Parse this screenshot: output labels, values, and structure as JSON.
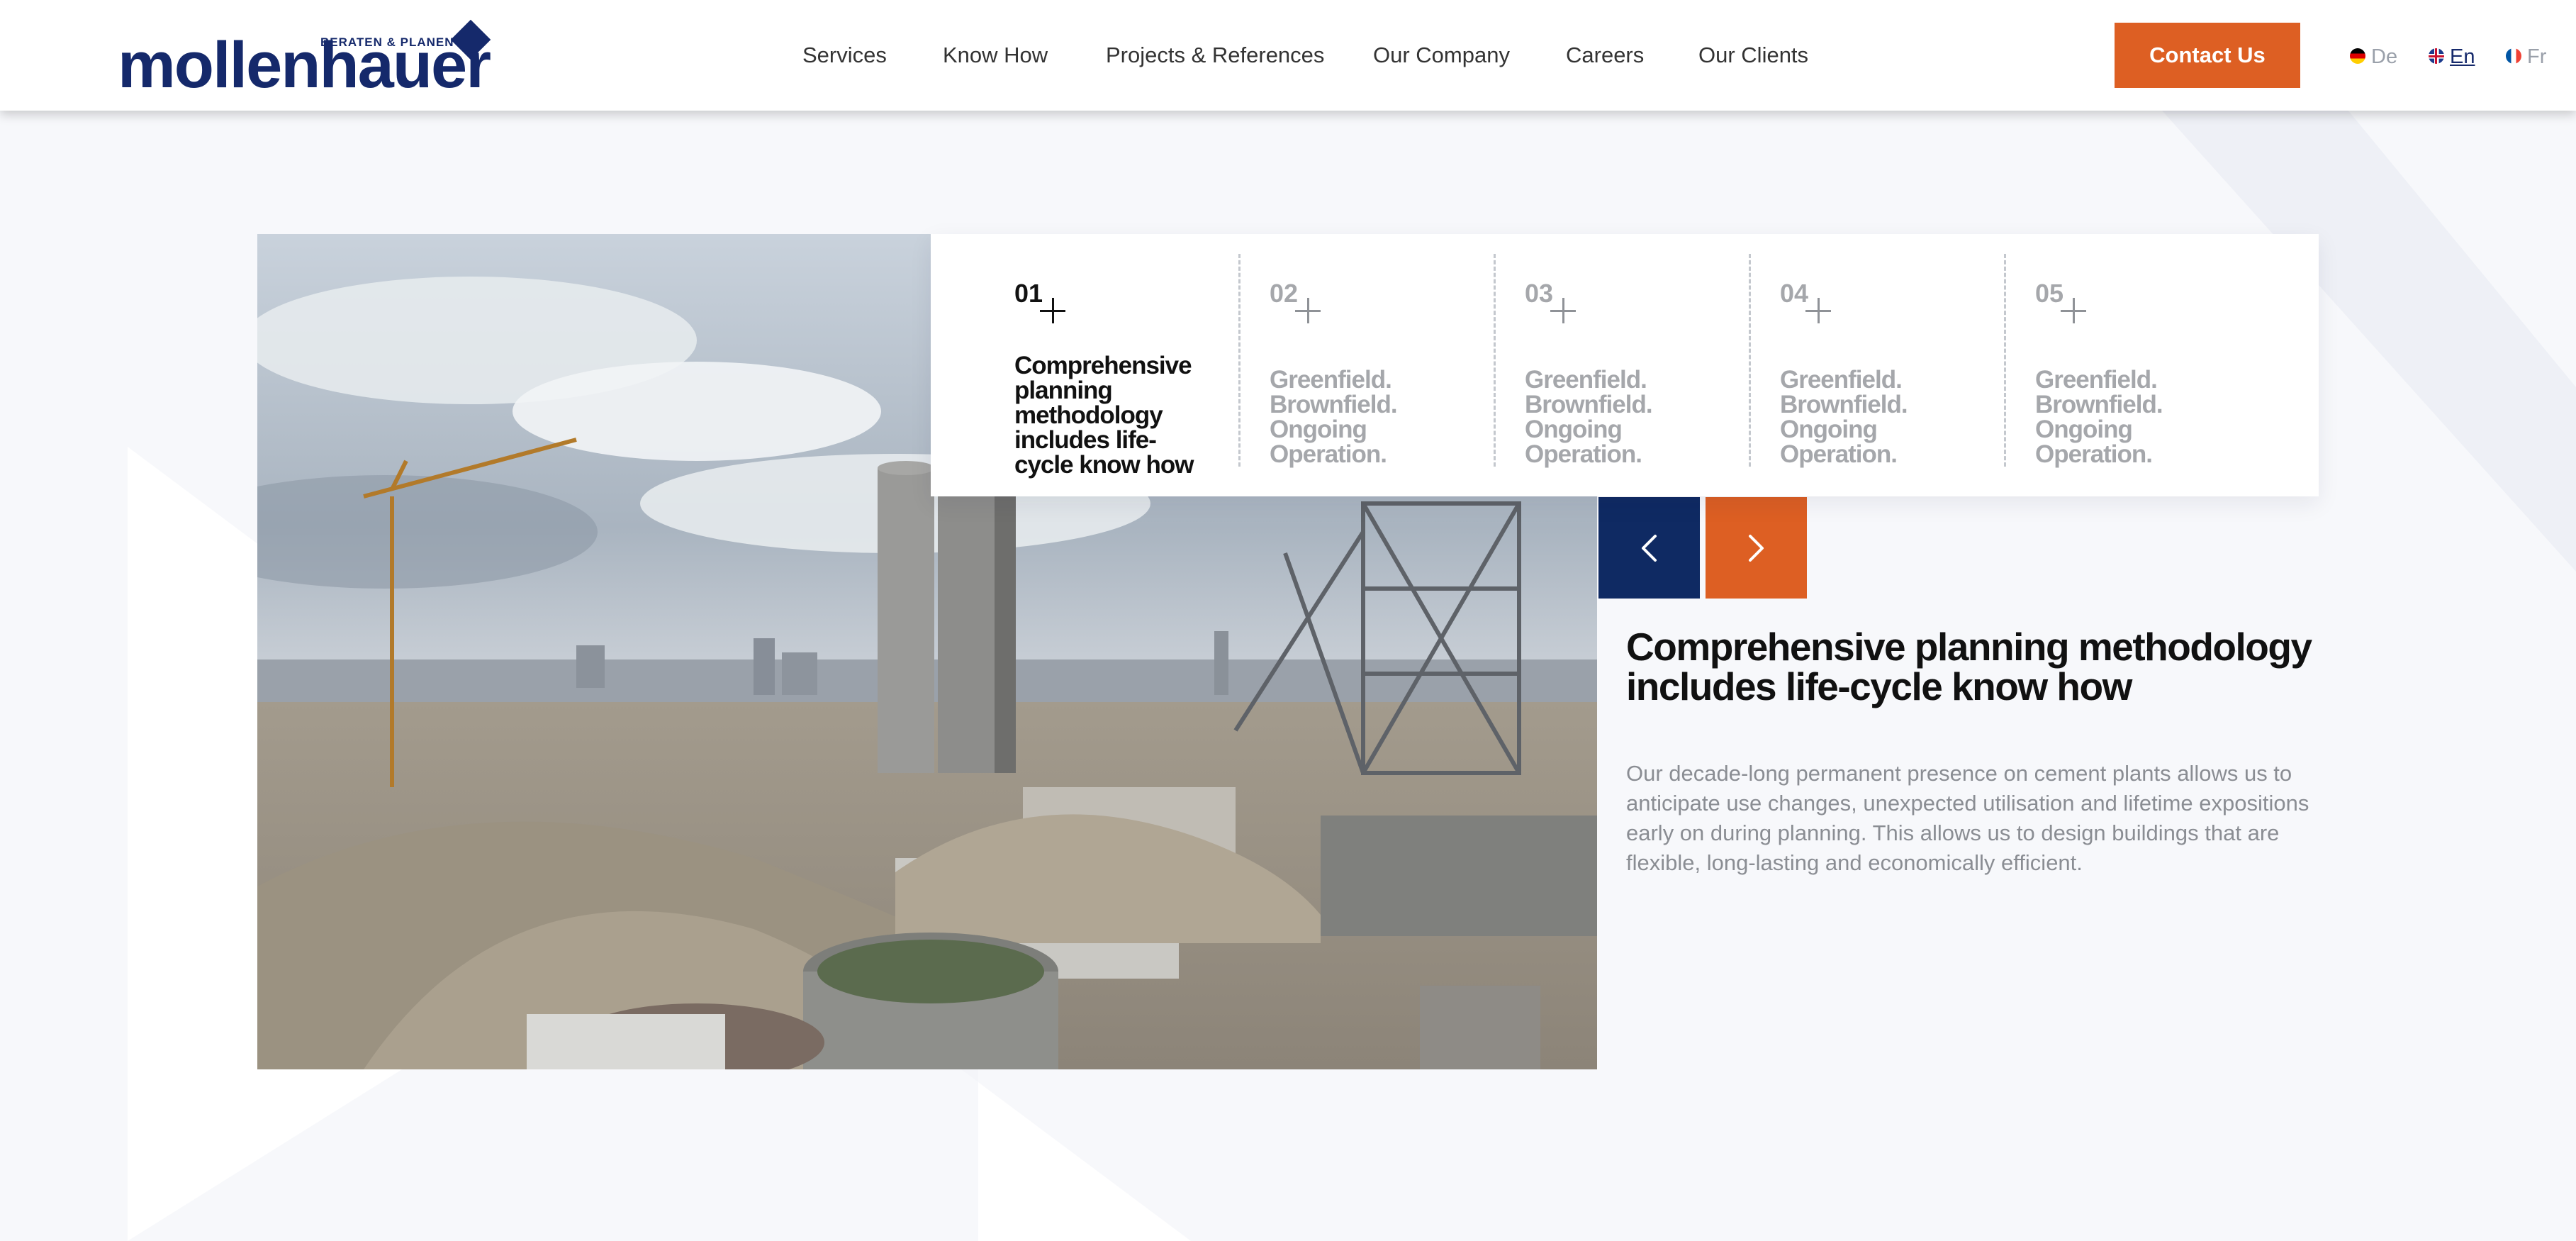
{
  "header": {
    "logo_text": "mollenhauer",
    "logo_tagline": "BERATEN & PLANEN",
    "nav": [
      {
        "label": "Services"
      },
      {
        "label": "Know How"
      },
      {
        "label": "Projects & References"
      },
      {
        "label": "Our Company"
      },
      {
        "label": "Careers"
      },
      {
        "label": "Our Clients"
      }
    ],
    "contact_button": "Contact Us",
    "languages": [
      {
        "label": "De",
        "flag": "flag-de",
        "active": false
      },
      {
        "label": "En",
        "flag": "flag-uk",
        "active": true
      },
      {
        "label": "Fr",
        "flag": "flag-fr",
        "active": false
      }
    ]
  },
  "colors": {
    "brand_navy": "#15296b",
    "accent_orange": "#dd5f23",
    "arrow_prev_bg": "#0f2a63",
    "text_muted": "#8a8d93"
  },
  "slider": {
    "active_index": 0,
    "tabs": [
      {
        "number": "01",
        "label": "Comprehensive planning methodology includes life-cycle know how",
        "active": true
      },
      {
        "number": "02",
        "label": "Greenfield. Brownfield. Ongoing Operation.",
        "active": false
      },
      {
        "number": "03",
        "label": "Greenfield. Brownfield. Ongoing Operation.",
        "active": false
      },
      {
        "number": "04",
        "label": "Greenfield. Brownfield. Ongoing Operation.",
        "active": false
      },
      {
        "number": "05",
        "label": "Greenfield. Brownfield. Ongoing Operation.",
        "active": false
      }
    ],
    "prev_icon": "chevron-left-icon",
    "next_icon": "chevron-right-icon"
  },
  "content": {
    "title": "Comprehensive planning methodology includes life-cycle know how",
    "body": "Our decade-long permanent presence on cement plants allows us to anticipate use changes, unexpected utilisation and lifetime expositions early on during planning. This allows us to design buildings that are flexible, long-lasting and economically efficient."
  }
}
